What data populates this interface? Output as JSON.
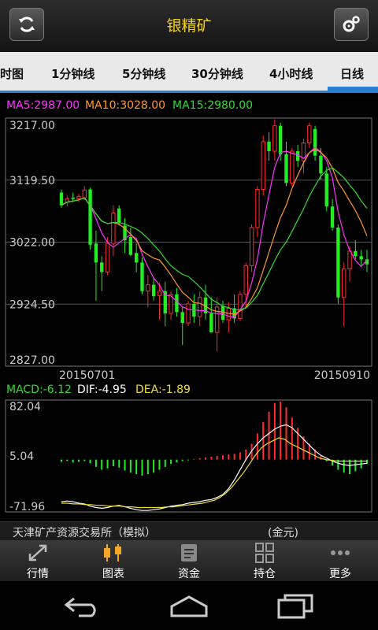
{
  "header": {
    "title": "银精矿"
  },
  "tabs": [
    {
      "label": "时图"
    },
    {
      "label": "1分钟线"
    },
    {
      "label": "5分钟线"
    },
    {
      "label": "30分钟线"
    },
    {
      "label": "4小时线"
    },
    {
      "label": "日线"
    }
  ],
  "active_tab": "日线",
  "ma_legend": {
    "ma5": "MA5:2987.00",
    "ma10": "MA10:3028.00",
    "ma15": "MA15:2980.00"
  },
  "macd_legend": {
    "macd": "MACD:-6.12",
    "dif": "DIF:-4.95",
    "dea": "DEA:-1.89"
  },
  "colors": {
    "up": "#ff2a2a",
    "down": "#22ee22",
    "ma5": "#ff33ff",
    "ma10": "#ff9933",
    "ma15": "#33dd33",
    "dif": "#ffffff",
    "dea": "#f0e030",
    "title": "#f2d21b",
    "tab_accent": "#2a7fd1"
  },
  "status": {
    "exchange": "天津矿产资源交易所（模拟）",
    "unit": "(金元)"
  },
  "bottom_nav": [
    {
      "label": "行情",
      "icon": "expand-arrows-icon"
    },
    {
      "label": "图表",
      "icon": "candlestick-icon",
      "active": true
    },
    {
      "label": "资金",
      "icon": "document-icon"
    },
    {
      "label": "持仓",
      "icon": "grid-icon"
    },
    {
      "label": "更多",
      "icon": "more-dots-icon"
    }
  ],
  "chart_data": [
    {
      "type": "candlestick",
      "y_ticks": [
        "3217.00",
        "3119.50",
        "3022.00",
        "2924.50",
        "2827.00"
      ],
      "ylim": [
        2827,
        3217
      ],
      "x_labels": [
        "20150701",
        "20150910"
      ],
      "ohlc": [
        [
          3100,
          3105,
          3076,
          3080
        ],
        [
          3085,
          3095,
          3078,
          3090
        ],
        [
          3092,
          3100,
          3085,
          3090
        ],
        [
          3090,
          3098,
          3085,
          3094
        ],
        [
          3092,
          3110,
          3088,
          3104
        ],
        [
          3105,
          3108,
          3010,
          3018
        ],
        [
          3020,
          3040,
          2930,
          2990
        ],
        [
          2990,
          3000,
          2945,
          2975
        ],
        [
          2975,
          3030,
          2970,
          3020
        ],
        [
          3020,
          3080,
          3000,
          3068
        ],
        [
          3075,
          3080,
          3048,
          3052
        ],
        [
          3048,
          3060,
          3005,
          3025
        ],
        [
          3030,
          3045,
          3000,
          3002
        ],
        [
          3005,
          3020,
          2975,
          2990
        ],
        [
          2990,
          2998,
          2940,
          2945
        ],
        [
          2945,
          2970,
          2920,
          2955
        ],
        [
          2955,
          2965,
          2930,
          2937
        ],
        [
          2938,
          2958,
          2900,
          2945
        ],
        [
          2945,
          2960,
          2890,
          2910
        ],
        [
          2910,
          2945,
          2900,
          2940
        ],
        [
          2940,
          2950,
          2905,
          2912
        ],
        [
          2912,
          2920,
          2860,
          2895
        ],
        [
          2895,
          2930,
          2890,
          2925
        ],
        [
          2925,
          2940,
          2895,
          2905
        ],
        [
          2905,
          2945,
          2890,
          2935
        ],
        [
          2935,
          2955,
          2900,
          2910
        ],
        [
          2910,
          2935,
          2880,
          2880
        ],
        [
          2880,
          2935,
          2850,
          2920
        ],
        [
          2922,
          2930,
          2895,
          2900
        ],
        [
          2900,
          2928,
          2880,
          2918
        ],
        [
          2918,
          2940,
          2895,
          2902
        ],
        [
          2902,
          2945,
          2898,
          2940
        ],
        [
          2940,
          2990,
          2920,
          2985
        ],
        [
          2985,
          3050,
          2975,
          3045
        ],
        [
          3045,
          3110,
          3030,
          3105
        ],
        [
          3105,
          3190,
          3095,
          3180
        ],
        [
          3180,
          3195,
          3150,
          3165
        ],
        [
          3165,
          3215,
          3150,
          3205
        ],
        [
          3205,
          3210,
          3150,
          3160
        ],
        [
          3160,
          3180,
          3110,
          3115
        ],
        [
          3115,
          3170,
          3110,
          3165
        ],
        [
          3165,
          3175,
          3140,
          3150
        ],
        [
          3150,
          3185,
          3130,
          3178
        ],
        [
          3178,
          3210,
          3170,
          3205
        ],
        [
          3200,
          3205,
          3150,
          3158
        ],
        [
          3158,
          3170,
          3120,
          3130
        ],
        [
          3130,
          3140,
          3070,
          3078
        ],
        [
          3078,
          3090,
          3040,
          3045
        ],
        [
          3045,
          3050,
          2925,
          2935
        ],
        [
          2935,
          2990,
          2890,
          2980
        ],
        [
          2980,
          3015,
          2960,
          3008
        ],
        [
          3008,
          3025,
          2995,
          3000
        ],
        [
          3000,
          3010,
          2985,
          2995
        ],
        [
          2995,
          3010,
          2975,
          2987
        ]
      ]
    },
    {
      "type": "bar+line",
      "y_ticks": [
        "82.04",
        "5.04",
        "-71.96"
      ],
      "ylim": [
        -71.96,
        82.04
      ],
      "macd": [
        -3,
        -2,
        -4,
        -3,
        -2,
        -5,
        -10,
        -14,
        -12,
        -9,
        -11,
        -15,
        -18,
        -20,
        -22,
        -20,
        -18,
        -14,
        -10,
        -6,
        -4,
        -2,
        -1,
        1,
        2,
        3,
        4,
        5,
        6,
        7,
        8,
        10,
        14,
        22,
        36,
        52,
        66,
        78,
        80,
        72,
        58,
        44,
        32,
        22,
        14,
        6,
        -2,
        -8,
        -14,
        -18,
        -20,
        -16,
        -12,
        -6
      ],
      "dif": [
        -58,
        -57,
        -58,
        -60,
        -61,
        -64,
        -66,
        -67,
        -66,
        -64,
        -63,
        -65,
        -67,
        -69,
        -70,
        -70,
        -69,
        -68,
        -66,
        -64,
        -63,
        -62,
        -60,
        -59,
        -58,
        -56,
        -55,
        -52,
        -48,
        -40,
        -28,
        -14,
        0,
        12,
        22,
        30,
        36,
        42,
        46,
        48,
        44,
        36,
        28,
        20,
        12,
        6,
        2,
        -2,
        -5,
        -7,
        -8,
        -7,
        -6,
        -5
      ],
      "dea": [
        -60,
        -60,
        -61,
        -61,
        -62,
        -62,
        -63,
        -63,
        -64,
        -64,
        -64,
        -65,
        -65,
        -66,
        -66,
        -66,
        -66,
        -66,
        -65,
        -65,
        -64,
        -63,
        -62,
        -61,
        -60,
        -58,
        -56,
        -52,
        -46,
        -38,
        -28,
        -18,
        -6,
        6,
        16,
        22,
        26,
        30,
        28,
        22,
        18,
        14,
        10,
        6,
        2,
        0,
        -1,
        -2,
        -2,
        -2,
        -2,
        -2,
        -2
      ]
    }
  ]
}
